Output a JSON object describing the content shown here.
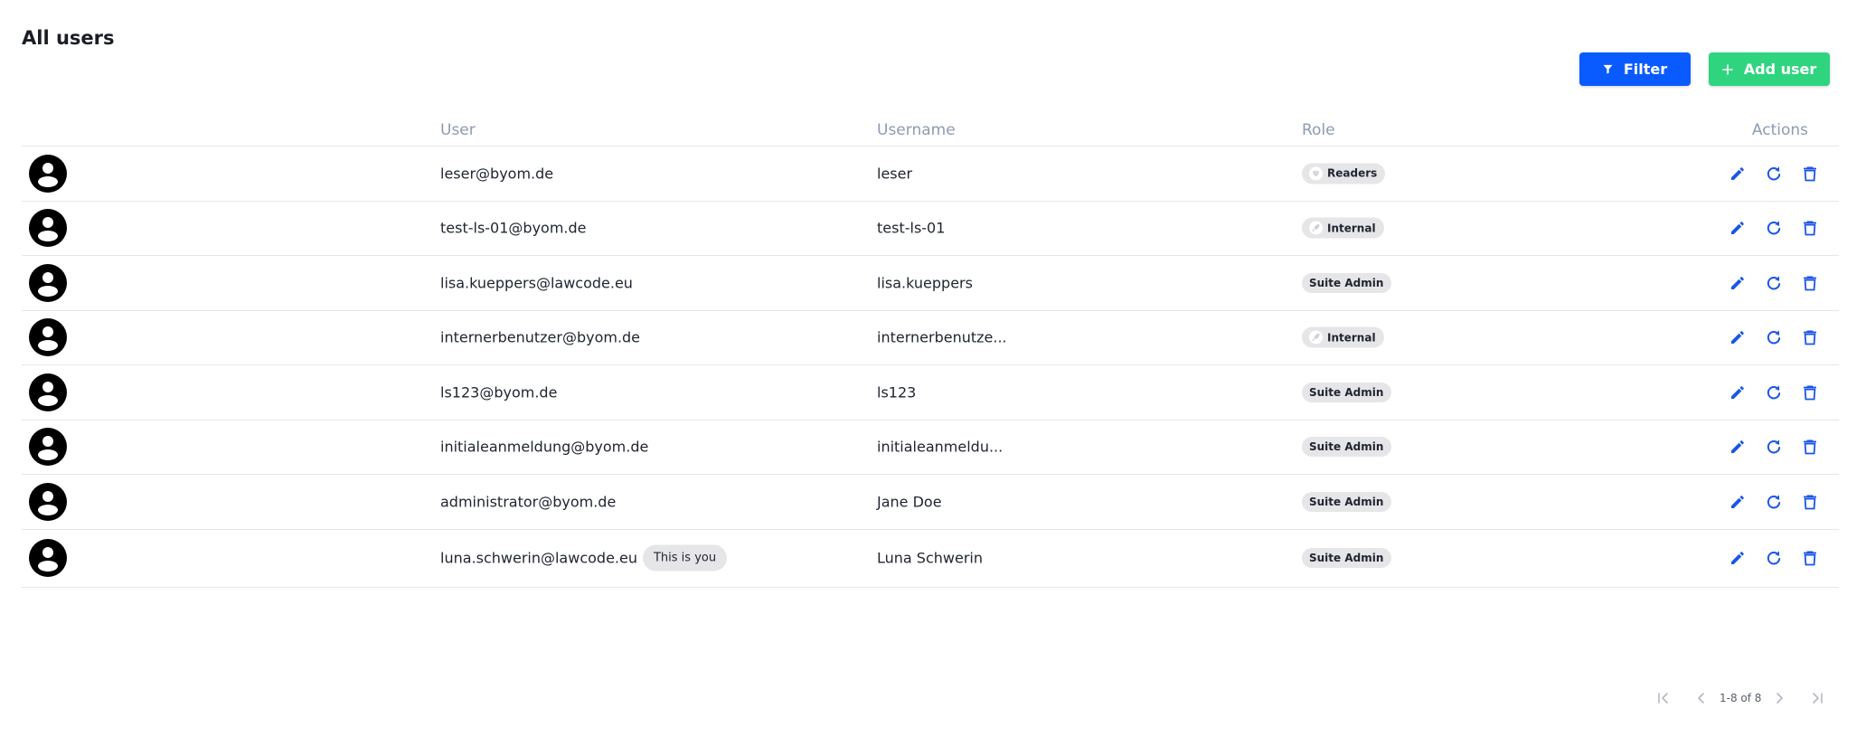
{
  "page": {
    "title": "All users"
  },
  "toolbar": {
    "filter_label": "Filter",
    "add_user_label": "Add user",
    "filter_icon": "filter-icon",
    "add_icon": "plus-icon"
  },
  "table": {
    "headers": {
      "user": "User",
      "username": "Username",
      "role": "Role",
      "actions": "Actions"
    },
    "rows": [
      {
        "user": "leser@byom.de",
        "username": "leser",
        "role": "Readers",
        "role_icon": "shield-icon",
        "you": ""
      },
      {
        "user": "test-ls-01@byom.de",
        "username": "test-ls-01",
        "role": "Internal",
        "role_icon": "rocket-icon",
        "you": ""
      },
      {
        "user": "lisa.kueppers@lawcode.eu",
        "username": "lisa.kueppers",
        "role": "Suite Admin",
        "role_icon": "",
        "you": ""
      },
      {
        "user": "internerbenutzer@byom.de",
        "username": "internerbenutze...",
        "role": "Internal",
        "role_icon": "rocket-icon",
        "you": ""
      },
      {
        "user": "ls123@byom.de",
        "username": "ls123",
        "role": "Suite Admin",
        "role_icon": "",
        "you": ""
      },
      {
        "user": "initialeanmeldung@byom.de",
        "username": "initialeanmeldu...",
        "role": "Suite Admin",
        "role_icon": "",
        "you": ""
      },
      {
        "user": "administrator@byom.de",
        "username": "Jane Doe",
        "role": "Suite Admin",
        "role_icon": "",
        "you": ""
      },
      {
        "user": "luna.schwerin@lawcode.eu",
        "username": "Luna Schwerin",
        "role": "Suite Admin",
        "role_icon": "",
        "you": "This is you"
      }
    ]
  },
  "pagination": {
    "info": "1-8 of 8"
  },
  "colors": {
    "primary": "#0a5bff",
    "success": "#2fd47f",
    "action_icon": "#1a56e8",
    "header_text": "#8e9ab3",
    "chip_bg": "#e6e6e9"
  }
}
